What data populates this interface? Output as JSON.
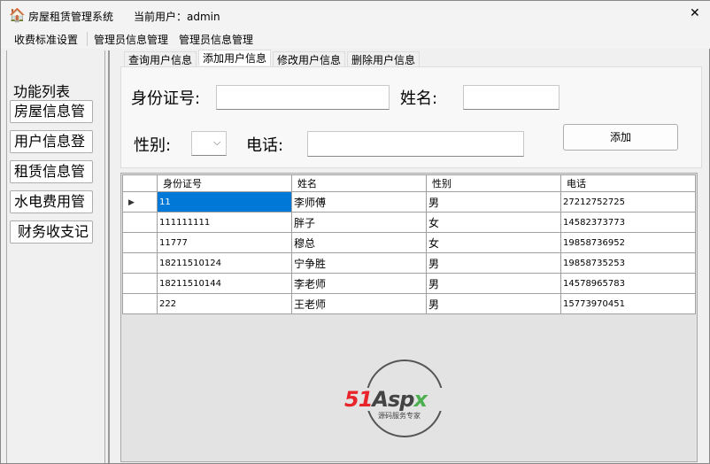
{
  "window": {
    "title": "房屋租赁管理系统",
    "current_user": "当前用户：admin",
    "close": "✕"
  },
  "menu": [
    "收费标准设置",
    "管理员信息管理",
    "管理员信息管理"
  ],
  "sidebar": {
    "group_title": "功能列表",
    "items": [
      "房屋信息管",
      "用户信息登",
      "租赁信息管",
      "水电费用管",
      "财务收支记"
    ]
  },
  "tabs": [
    "查询用户信息",
    "添加用户信息",
    "修改用户信息",
    "删除用户信息"
  ],
  "active_tab": 1,
  "form": {
    "id_label": "身份证号:",
    "id_value": "",
    "name_label": "姓名:",
    "name_value": "",
    "gender_label": "性别:",
    "gender_value": "",
    "phone_label": "电话:",
    "phone_value": "",
    "add_button": "添加"
  },
  "grid": {
    "columns": [
      "身份证号",
      "姓名",
      "性别",
      "电话"
    ],
    "rows": [
      [
        "11",
        "李师傅",
        "男",
        "27212752725"
      ],
      [
        "111111111",
        "胖子",
        "女",
        "14582373773"
      ],
      [
        "11777",
        "穆总",
        "女",
        "19858736952"
      ],
      [
        "18211510124",
        "宁争胜",
        "男",
        "19858735253"
      ],
      [
        "18211510144",
        "李老师",
        "男",
        "14578965783"
      ],
      [
        "222",
        "王老师",
        "男",
        "15773970451"
      ]
    ]
  },
  "watermark": {
    "logo": "51Aspx",
    "tagline": "源码服务专家"
  },
  "colors": {
    "selection": "#0078d7",
    "logo_red": "#e8252b",
    "logo_green": "#4caf50"
  }
}
